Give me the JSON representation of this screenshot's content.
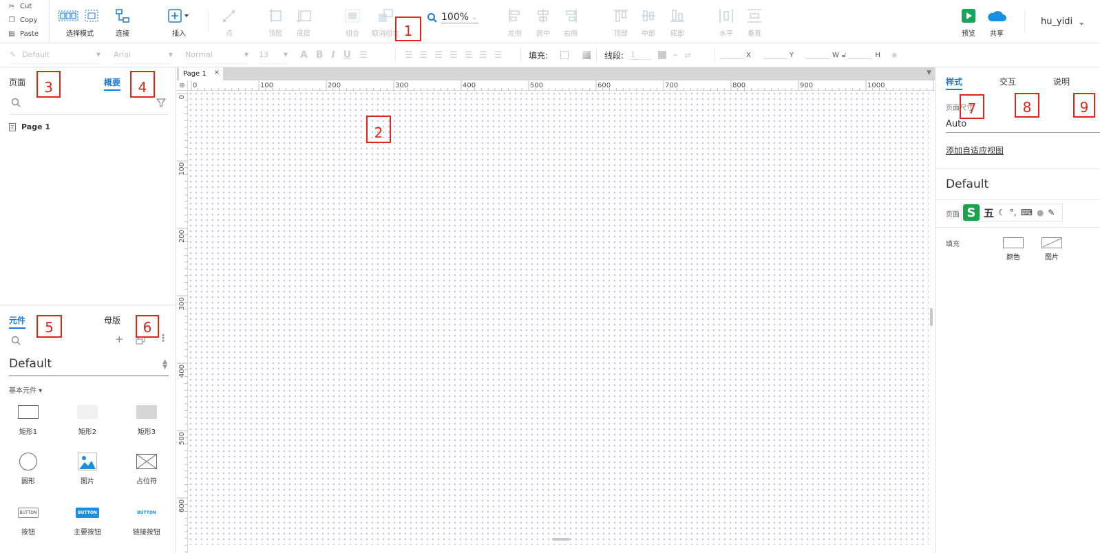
{
  "clipboard": {
    "cut": "Cut",
    "copy": "Copy",
    "paste": "Paste"
  },
  "toolbar": {
    "select_mode": "选择模式",
    "connect": "连接",
    "insert": "插入",
    "point": "点",
    "top_layer": "顶层",
    "bottom_layer": "底层",
    "group": "组合",
    "ungroup": "取消组合",
    "zoom": "100%",
    "align_left": "左侧",
    "align_center": "居中",
    "align_right": "右侧",
    "align_top": "顶部",
    "align_middle": "中部",
    "align_bottom": "底部",
    "distribute_h": "水平",
    "distribute_v": "垂直",
    "preview": "预览",
    "share": "共享",
    "username": "hu_yidi"
  },
  "formatbar": {
    "style": "Default",
    "font": "Arial",
    "weight": "Normal",
    "size": "13",
    "fill_label": "填充:",
    "stroke_label": "线段:",
    "stroke_value": "1",
    "x_label": "X",
    "y_label": "Y",
    "w_label": "W",
    "h_label": "H"
  },
  "pages_panel": {
    "tab_pages": "页面",
    "tab_outline": "概要",
    "items": [
      {
        "label": "Page 1"
      }
    ]
  },
  "components_panel": {
    "tab_widgets": "元件",
    "tab_masters": "母版",
    "library": "Default",
    "category": "基本元件 ▾",
    "items": [
      {
        "label": "矩形1"
      },
      {
        "label": "矩形2"
      },
      {
        "label": "矩形3"
      },
      {
        "label": "圆形"
      },
      {
        "label": "图片"
      },
      {
        "label": "占位符"
      },
      {
        "label": "按钮"
      },
      {
        "label": "主要按钮"
      },
      {
        "label": "链接按钮"
      }
    ],
    "button_text": "BUTTON"
  },
  "canvas": {
    "page_tab": "Page 1",
    "ruler_top": [
      "0",
      "100",
      "200",
      "300",
      "400",
      "500",
      "600",
      "700",
      "800",
      "900",
      "1000"
    ],
    "ruler_left": [
      "0",
      "100",
      "200",
      "300",
      "400",
      "500",
      "600"
    ]
  },
  "right_panel": {
    "tab_style": "样式",
    "tab_interaction": "交互",
    "tab_notes": "说明",
    "page_size_label": "页面尺寸",
    "page_size_value": "Auto",
    "adaptive_link": "添加自适应视图",
    "style_name": "Default",
    "page_align_label": "页面",
    "ime_five": "五",
    "fill_label": "填充",
    "fill_color": "颜色",
    "fill_image": "图片"
  },
  "annotations": [
    "1",
    "2",
    "3",
    "4",
    "5",
    "6",
    "7",
    "8",
    "9"
  ],
  "colors": {
    "accent": "#1a7bd6",
    "annotation": "#e1251b",
    "grid_dot": "#6a78ff",
    "preview_green": "#17a45b"
  }
}
